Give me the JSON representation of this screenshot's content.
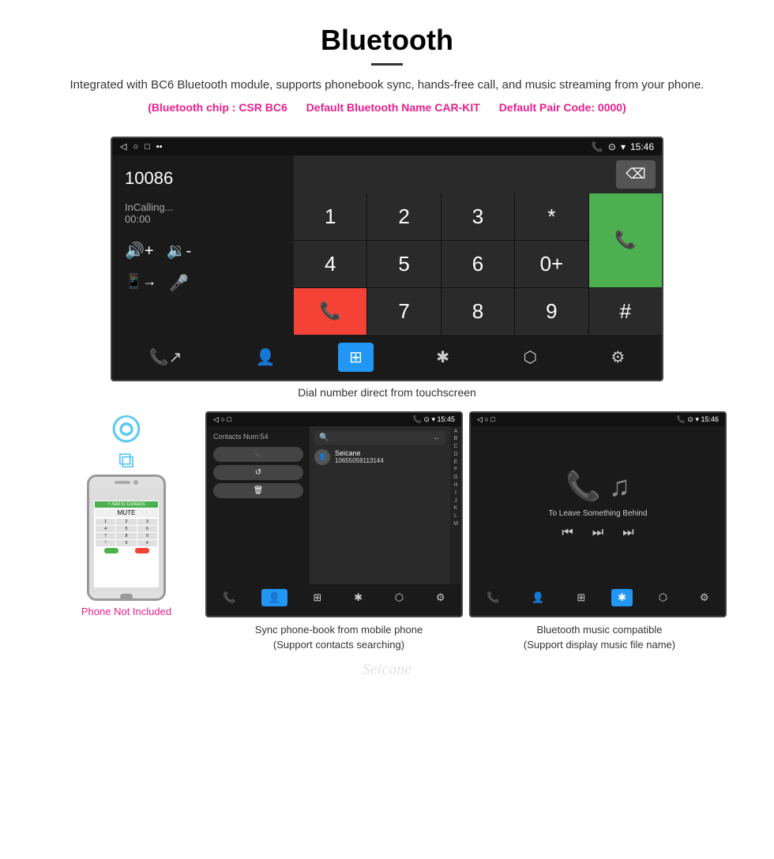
{
  "header": {
    "title": "Bluetooth",
    "description": "Integrated with BC6 Bluetooth module, supports phonebook sync, hands-free call, and music streaming from your phone.",
    "specs": [
      "(Bluetooth chip : CSR BC6",
      "Default Bluetooth Name CAR-KIT",
      "Default Pair Code: 0000)"
    ]
  },
  "main_screen": {
    "status": {
      "left": [
        "◁",
        "○",
        "□",
        "▪▪"
      ],
      "right": [
        "📞",
        "⊙",
        "▾",
        "15:46"
      ]
    },
    "dial": {
      "number": "10086",
      "calling_label": "InCalling...",
      "timer": "00:00"
    },
    "numpad": [
      "1",
      "2",
      "3",
      "*",
      "4",
      "5",
      "6",
      "0+",
      "7",
      "8",
      "9",
      "#"
    ],
    "bottom_nav": [
      "↗📞",
      "👤",
      "⊞",
      "✱",
      "⬡",
      "⚙"
    ]
  },
  "caption_dial": "Dial number direct from touchscreen",
  "phone_section": {
    "bluetooth_symbol": "☈",
    "not_included": "Phone Not Included"
  },
  "contacts_screen": {
    "status_left": "◁  ○  □  ▪▪",
    "status_right": "📞 ⊙ ▾ 15:45",
    "contacts_num": "Contacts Num:54",
    "search_placeholder": "Search",
    "contact_name": "Seicane",
    "contact_number": "10655059113144",
    "alphabet": [
      "A",
      "B",
      "C",
      "D",
      "E",
      "F",
      "G",
      "H",
      "I",
      "J",
      "K",
      "L",
      "M"
    ],
    "buttons": [
      "📞",
      "↺",
      "🗑"
    ],
    "bottom_nav_items": [
      "↗📞",
      "👤",
      "⊞",
      "✱",
      "⬡",
      "⚙"
    ],
    "active_nav": 1
  },
  "music_screen": {
    "status_left": "◁  ○  □  ▪▪",
    "status_right": "📞 ⊙ ▾ 15:46",
    "song_title": "To Leave Something Behind",
    "controls": [
      "⏮",
      "⏭",
      "⏭⏭"
    ],
    "bottom_nav_items": [
      "↗📞",
      "👤",
      "⊞",
      "✱",
      "⬡",
      "⚙"
    ],
    "active_nav": 3
  },
  "captions": {
    "contacts": "Sync phone-book from mobile phone\n(Support contacts searching)",
    "music": "Bluetooth music compatible\n(Support display music file name)"
  },
  "watermark": "Seicane"
}
